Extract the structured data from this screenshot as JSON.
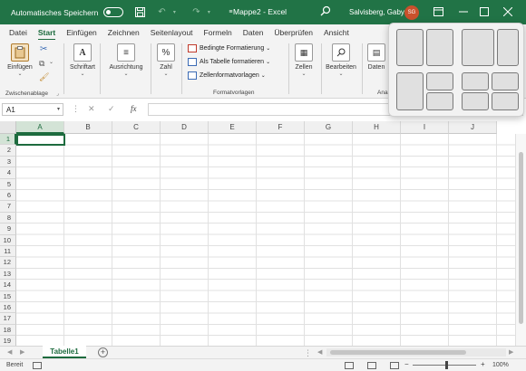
{
  "titlebar": {
    "autosave_label": "Automatisches Speichern",
    "doc_title": "Mappe2  -  Excel",
    "user_name": "Salvisberg, Gaby",
    "avatar_initials": "SG",
    "accent_color": "#217346",
    "avatar_color": "#c8512c"
  },
  "ribbon": {
    "tabs": [
      "Datei",
      "Start",
      "Einfügen",
      "Zeichnen",
      "Seitenlayout",
      "Formeln",
      "Daten",
      "Überprüfen",
      "Ansicht"
    ],
    "active_tab": "Start",
    "clipboard": {
      "paste": "Einfügen",
      "group": "Zwischenablage"
    },
    "font": {
      "label": "Schriftart"
    },
    "alignment": {
      "label": "Ausrichtung"
    },
    "number": {
      "label": "Zahl"
    },
    "styles": {
      "conditional": "Bedingte Formatierung",
      "as_table": "Als Tabelle formatieren",
      "cell_styles": "Zellenformatvorlagen",
      "group": "Formatvorlagen"
    },
    "cells": {
      "label": "Zellen"
    },
    "editing": {
      "label": "Bearbeiten"
    },
    "data_label_partial": "Daten",
    "partial_group_label": "Ana"
  },
  "formula_bar": {
    "name_box": "A1",
    "fx": "fx",
    "cancel": "✕",
    "enter": "✓",
    "formula": ""
  },
  "grid": {
    "columns": [
      "A",
      "B",
      "C",
      "D",
      "E",
      "F",
      "G",
      "H",
      "I",
      "J"
    ],
    "rows": [
      "1",
      "2",
      "3",
      "4",
      "5",
      "6",
      "7",
      "8",
      "9",
      "10",
      "11",
      "12",
      "13",
      "14",
      "15",
      "16",
      "17",
      "18",
      "19"
    ],
    "active_cell": "A1"
  },
  "sheets": {
    "tabs": [
      "Tabelle1"
    ],
    "add_label": "+"
  },
  "status": {
    "text": "Bereit",
    "zoom": "100%"
  },
  "snap_layouts": {
    "visible": true,
    "layouts": 4
  }
}
